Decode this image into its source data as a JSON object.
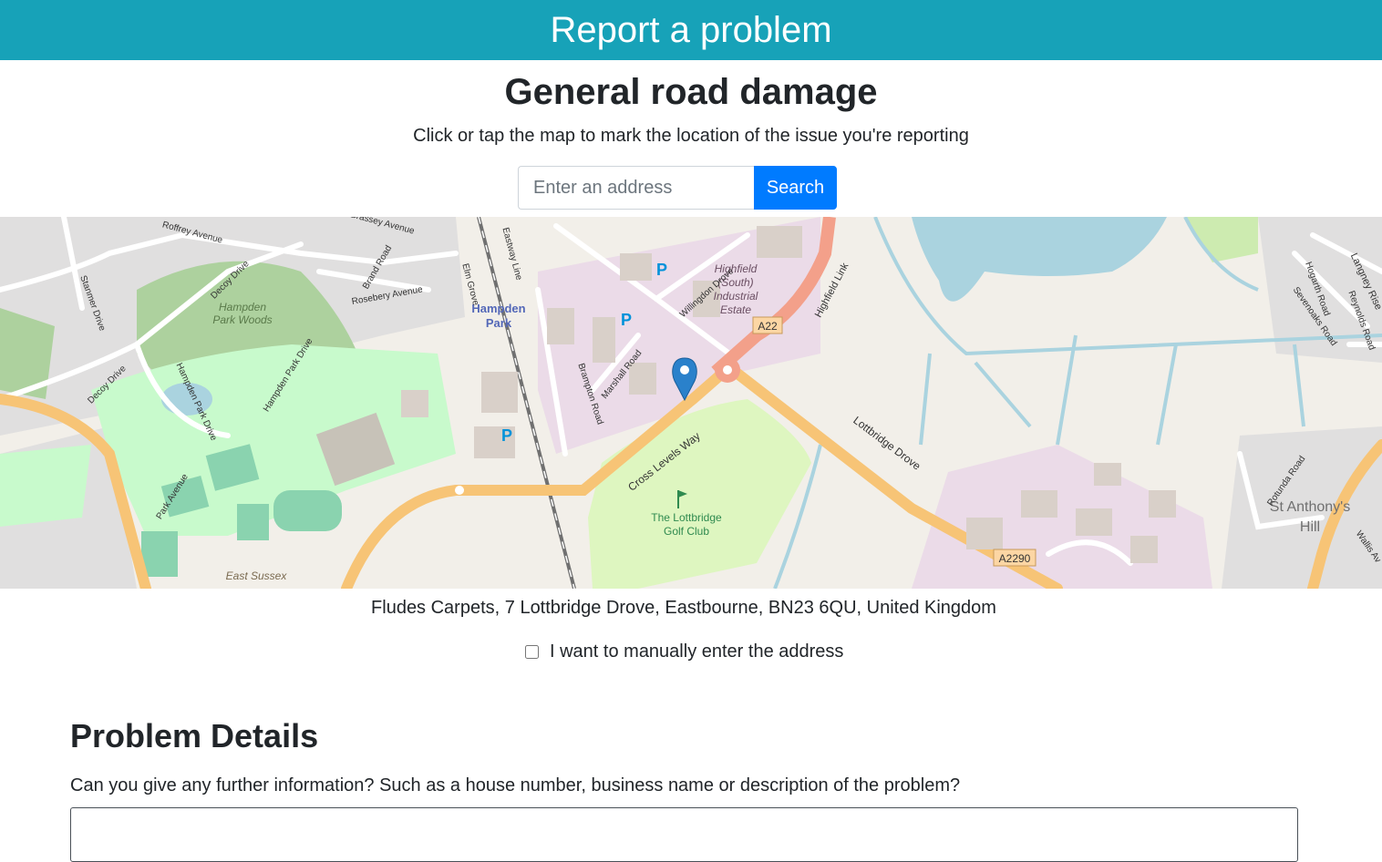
{
  "header": {
    "title": "Report a problem"
  },
  "page": {
    "title": "General road damage",
    "instructions": "Click or tap the map to mark the location of the issue you're reporting"
  },
  "search": {
    "placeholder": "Enter an address",
    "button_label": "Search"
  },
  "map": {
    "marker_color": "#2a81cb",
    "labels": {
      "hampden_park": "Hampden",
      "hampden_park_2": "Park",
      "hampden_park_woods": "Hampden",
      "hampden_park_woods_2": "Park Woods",
      "highfield": "Highfield",
      "highfield_2": "(South)",
      "highfield_3": "Industrial",
      "highfield_4": "Estate",
      "golf": "The Lottbridge",
      "golf_2": "Golf Club",
      "st_anthonys": "St Anthony's",
      "st_anthonys_2": "Hill",
      "east_sussex": "East Sussex",
      "a22": "A22",
      "a2290": "A2290",
      "cross_levels_way": "Cross Levels Way",
      "lottbridge_drove": "Lottbridge Drove",
      "highfield_link": "Highfield Link",
      "willingdon_drove": "Willingdon Drove",
      "marshall_road": "Marshall Road",
      "brampton_road": "Brampton Road",
      "brassey_avenue": "Brassey Avenue",
      "roffrey_avenue": "Roffrey Avenue",
      "decoy_drive": "Decoy Drive",
      "decoy_drive_2": "Decoy Drive",
      "hampden_park_drive": "Hampden Park Drive",
      "hampden_park_drive_2": "Hampden Park Drive",
      "park_avenue": "Park Avenue",
      "rosebery_avenue": "Rosebery Avenue",
      "brand_road": "Brand Road",
      "elm_grove": "Elm Grove",
      "stanmer_drive": "Stanmer Drive",
      "rotunda_road": "Rotunda Road",
      "langney_rise": "Langney Rise",
      "hogarth_road": "Hogarth Road",
      "reynolds_road": "Reynolds Road",
      "sevenoaks_road": "Sevenoaks Road",
      "wallis_av": "Wallis Av",
      "railway_line": "Eastway Line",
      "parking": "P"
    }
  },
  "location": {
    "address": "Fludes Carpets, 7 Lottbridge Drove, Eastbourne, BN23 6QU, United Kingdom",
    "manual_label": "I want to manually enter the address",
    "manual_checked": false
  },
  "details": {
    "section_title": "Problem Details",
    "question": "Can you give any further information? Such as a house number, business name or description of the problem?"
  }
}
